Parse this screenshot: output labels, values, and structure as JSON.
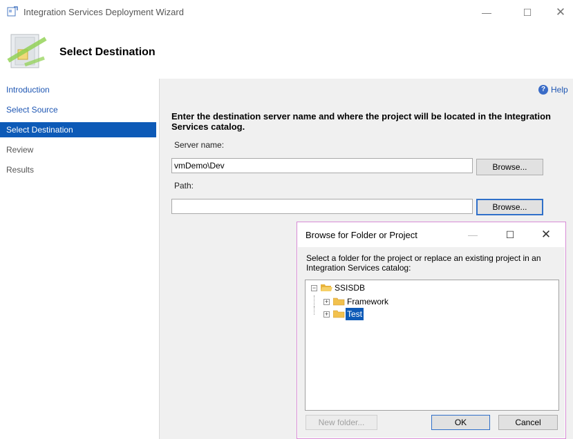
{
  "window": {
    "title": "Integration Services Deployment Wizard",
    "minimize_glyph": "—",
    "maximize_glyph": "☐",
    "close_glyph": "✕"
  },
  "header": {
    "title": "Select Destination"
  },
  "sidebar": {
    "items": [
      {
        "label": "Introduction",
        "state": "link"
      },
      {
        "label": "Select Source",
        "state": "link"
      },
      {
        "label": "Select Destination",
        "state": "active"
      },
      {
        "label": "Review",
        "state": "disabled"
      },
      {
        "label": "Results",
        "state": "disabled"
      }
    ]
  },
  "main": {
    "help_label": "Help",
    "help_glyph": "?",
    "instruction": "Enter the destination server name and where the project will be located in the Integration Services catalog.",
    "server_label": "Server name:",
    "server_value": "vmDemo\\Dev",
    "browse_label": "Browse...",
    "path_label": "Path:",
    "path_value": "",
    "path_browse_label": "Browse..."
  },
  "dialog": {
    "title": "Browse for Folder or Project",
    "minimize_glyph": "—",
    "maximize_glyph": "☐",
    "close_glyph": "✕",
    "description": "Select a folder for the project or replace an existing project in an Integration Services catalog:",
    "tree": {
      "root": {
        "label": "SSISDB",
        "expander": "−"
      },
      "children": [
        {
          "label": "Framework",
          "expander": "+",
          "selected": false
        },
        {
          "label": "Test",
          "expander": "+",
          "selected": true
        }
      ]
    },
    "new_folder_label": "New folder...",
    "ok_label": "OK",
    "cancel_label": "Cancel"
  },
  "colors": {
    "selection": "#0d5ab7",
    "link": "#1e56b3",
    "panel": "#f0f0f0",
    "dialog_border": "#d78ad5",
    "folder": "#f2c14e"
  }
}
